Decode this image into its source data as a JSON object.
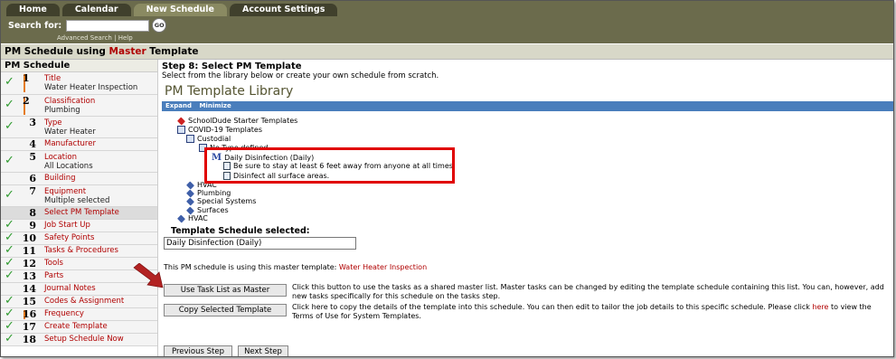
{
  "tabs": [
    {
      "label": "Home"
    },
    {
      "label": "Calendar"
    },
    {
      "label": "New Schedule",
      "active": true
    },
    {
      "label": "Account Settings"
    }
  ],
  "search": {
    "label": "Search for:",
    "value": "",
    "go_label": "GO",
    "advanced": "Advanced Search",
    "separator": "|",
    "help": "Help"
  },
  "page": {
    "title_pre": "PM Schedule using ",
    "title_master": "Master",
    "title_post": " Template"
  },
  "sidebar": {
    "title": "PM Schedule",
    "steps": [
      {
        "num": "1",
        "label": "Title",
        "sub": "Water Heater Inspection",
        "checked": true,
        "bar": true
      },
      {
        "num": "2",
        "label": "Classification",
        "sub": "Plumbing",
        "checked": true,
        "bar": true
      },
      {
        "num": "3",
        "label": "Type",
        "sub": "Water Heater",
        "checked": true
      },
      {
        "num": "4",
        "label": "Manufacturer",
        "sub": "",
        "checked": false
      },
      {
        "num": "5",
        "label": "Location",
        "sub": "All Locations",
        "checked": true
      },
      {
        "num": "6",
        "label": "Building",
        "sub": "",
        "checked": false
      },
      {
        "num": "7",
        "label": "Equipment",
        "sub": "Multiple selected",
        "checked": true
      },
      {
        "num": "8",
        "label": "Select PM Template",
        "sub": "",
        "checked": false,
        "current": true
      },
      {
        "num": "9",
        "label": "Job Start Up",
        "sub": "",
        "checked": true
      },
      {
        "num": "10",
        "label": "Safety Points",
        "sub": "",
        "checked": true
      },
      {
        "num": "11",
        "label": "Tasks & Procedures",
        "sub": "",
        "checked": true
      },
      {
        "num": "12",
        "label": "Tools",
        "sub": "",
        "checked": true
      },
      {
        "num": "13",
        "label": "Parts",
        "sub": "",
        "checked": true
      },
      {
        "num": "14",
        "label": "Journal Notes",
        "sub": "",
        "checked": false
      },
      {
        "num": "15",
        "label": "Codes & Assignment",
        "sub": "",
        "checked": true
      },
      {
        "num": "16",
        "label": "Frequency",
        "sub": "",
        "checked": true,
        "bar": true
      },
      {
        "num": "17",
        "label": "Create Template",
        "sub": "",
        "checked": true
      },
      {
        "num": "18",
        "label": "Setup Schedule Now",
        "sub": "",
        "checked": true
      }
    ]
  },
  "main": {
    "heading": "Step 8: Select PM Template",
    "description": "Select from the library below or create your own schedule from scratch.",
    "library_title": "PM Template Library",
    "expand": "Expand",
    "minimize": "Minimize",
    "tree": [
      {
        "text": "SchoolDude Starter Templates",
        "icon": "red-diamond-icon"
      },
      {
        "text": "COVID-19 Templates",
        "icon": "book-icon"
      },
      {
        "text": "Custodial",
        "icon": "book-icon"
      },
      {
        "text": "No Type defined",
        "icon": "book-icon"
      },
      {
        "text": "Daily Disinfection (Daily)",
        "icon": "master-m-icon"
      },
      {
        "text": "Be sure to stay at least 6 feet away from anyone at all times.",
        "icon": "task-doc-icon"
      },
      {
        "text": "Disinfect all surface areas.",
        "icon": "task-doc-icon"
      },
      {
        "text": "HVAC",
        "icon": "blue-diamond-icon"
      },
      {
        "text": "Plumbing",
        "icon": "blue-diamond-icon"
      },
      {
        "text": "Special Systems",
        "icon": "blue-diamond-icon"
      },
      {
        "text": "Surfaces",
        "icon": "blue-diamond-icon"
      },
      {
        "text": "HVAC",
        "icon": "blue-diamond-icon"
      }
    ],
    "selected_label": "Template Schedule selected:",
    "selected_value": "Daily Disinfection (Daily)",
    "master_note": "This PM schedule is using this master template:",
    "master_link": "Water Heater Inspection",
    "use_task_btn": "Use Task List as Master",
    "use_task_desc": "Click this button to use the tasks as a shared master list. Master tasks can be changed by editing the template schedule containing this list. You can, however, add new tasks specifically for this schedule on the tasks step.",
    "copy_btn": "Copy Selected Template",
    "copy_desc_1": "Click here to copy the details of the template into this schedule. You can then edit to tailor the job details to this specific schedule. Please click",
    "copy_link": "here",
    "copy_desc_2": "to view the Terms of Use for System Templates.",
    "prev_btn": "Previous Step",
    "next_btn": "Next Step"
  },
  "colors": {
    "header": "#6b6b4c",
    "accent_red": "#b00000",
    "check_green": "#2f9a2f",
    "library_bar": "#4a7ebc",
    "highlight": "#e00000"
  }
}
